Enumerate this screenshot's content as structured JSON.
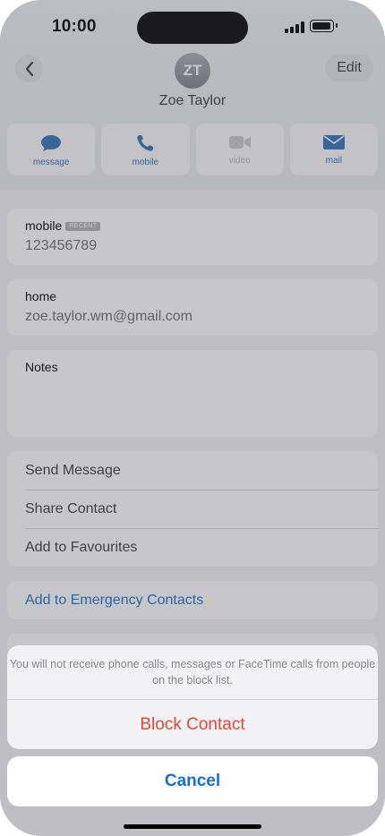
{
  "status_bar": {
    "time": "10:00"
  },
  "header": {
    "back_icon": "chevron-left-icon",
    "edit_label": "Edit",
    "avatar_initials": "ZT",
    "contact_name": "Zoe Taylor"
  },
  "actions": [
    {
      "label": "message",
      "icon": "message-icon",
      "enabled": true
    },
    {
      "label": "mobile",
      "icon": "phone-icon",
      "enabled": true
    },
    {
      "label": "video",
      "icon": "video-icon",
      "enabled": false
    },
    {
      "label": "mail",
      "icon": "mail-icon",
      "enabled": true
    }
  ],
  "phone_field": {
    "label": "mobile",
    "badge": "RECENT",
    "value": "123456789"
  },
  "email_field": {
    "label": "home",
    "value": "zoe.taylor.wm@gmail.com"
  },
  "notes_field": {
    "label": "Notes"
  },
  "options": [
    {
      "label": "Send Message"
    },
    {
      "label": "Share Contact"
    },
    {
      "label": "Add to Favourites"
    }
  ],
  "emergency": {
    "label": "Add to Emergency Contacts"
  },
  "action_sheet": {
    "message": "You will not receive phone calls, messages or FaceTime calls from people on the block list.",
    "block_label": "Block Contact",
    "cancel_label": "Cancel"
  },
  "colors": {
    "accent": "#1570d8",
    "destructive": "#e5453b"
  }
}
